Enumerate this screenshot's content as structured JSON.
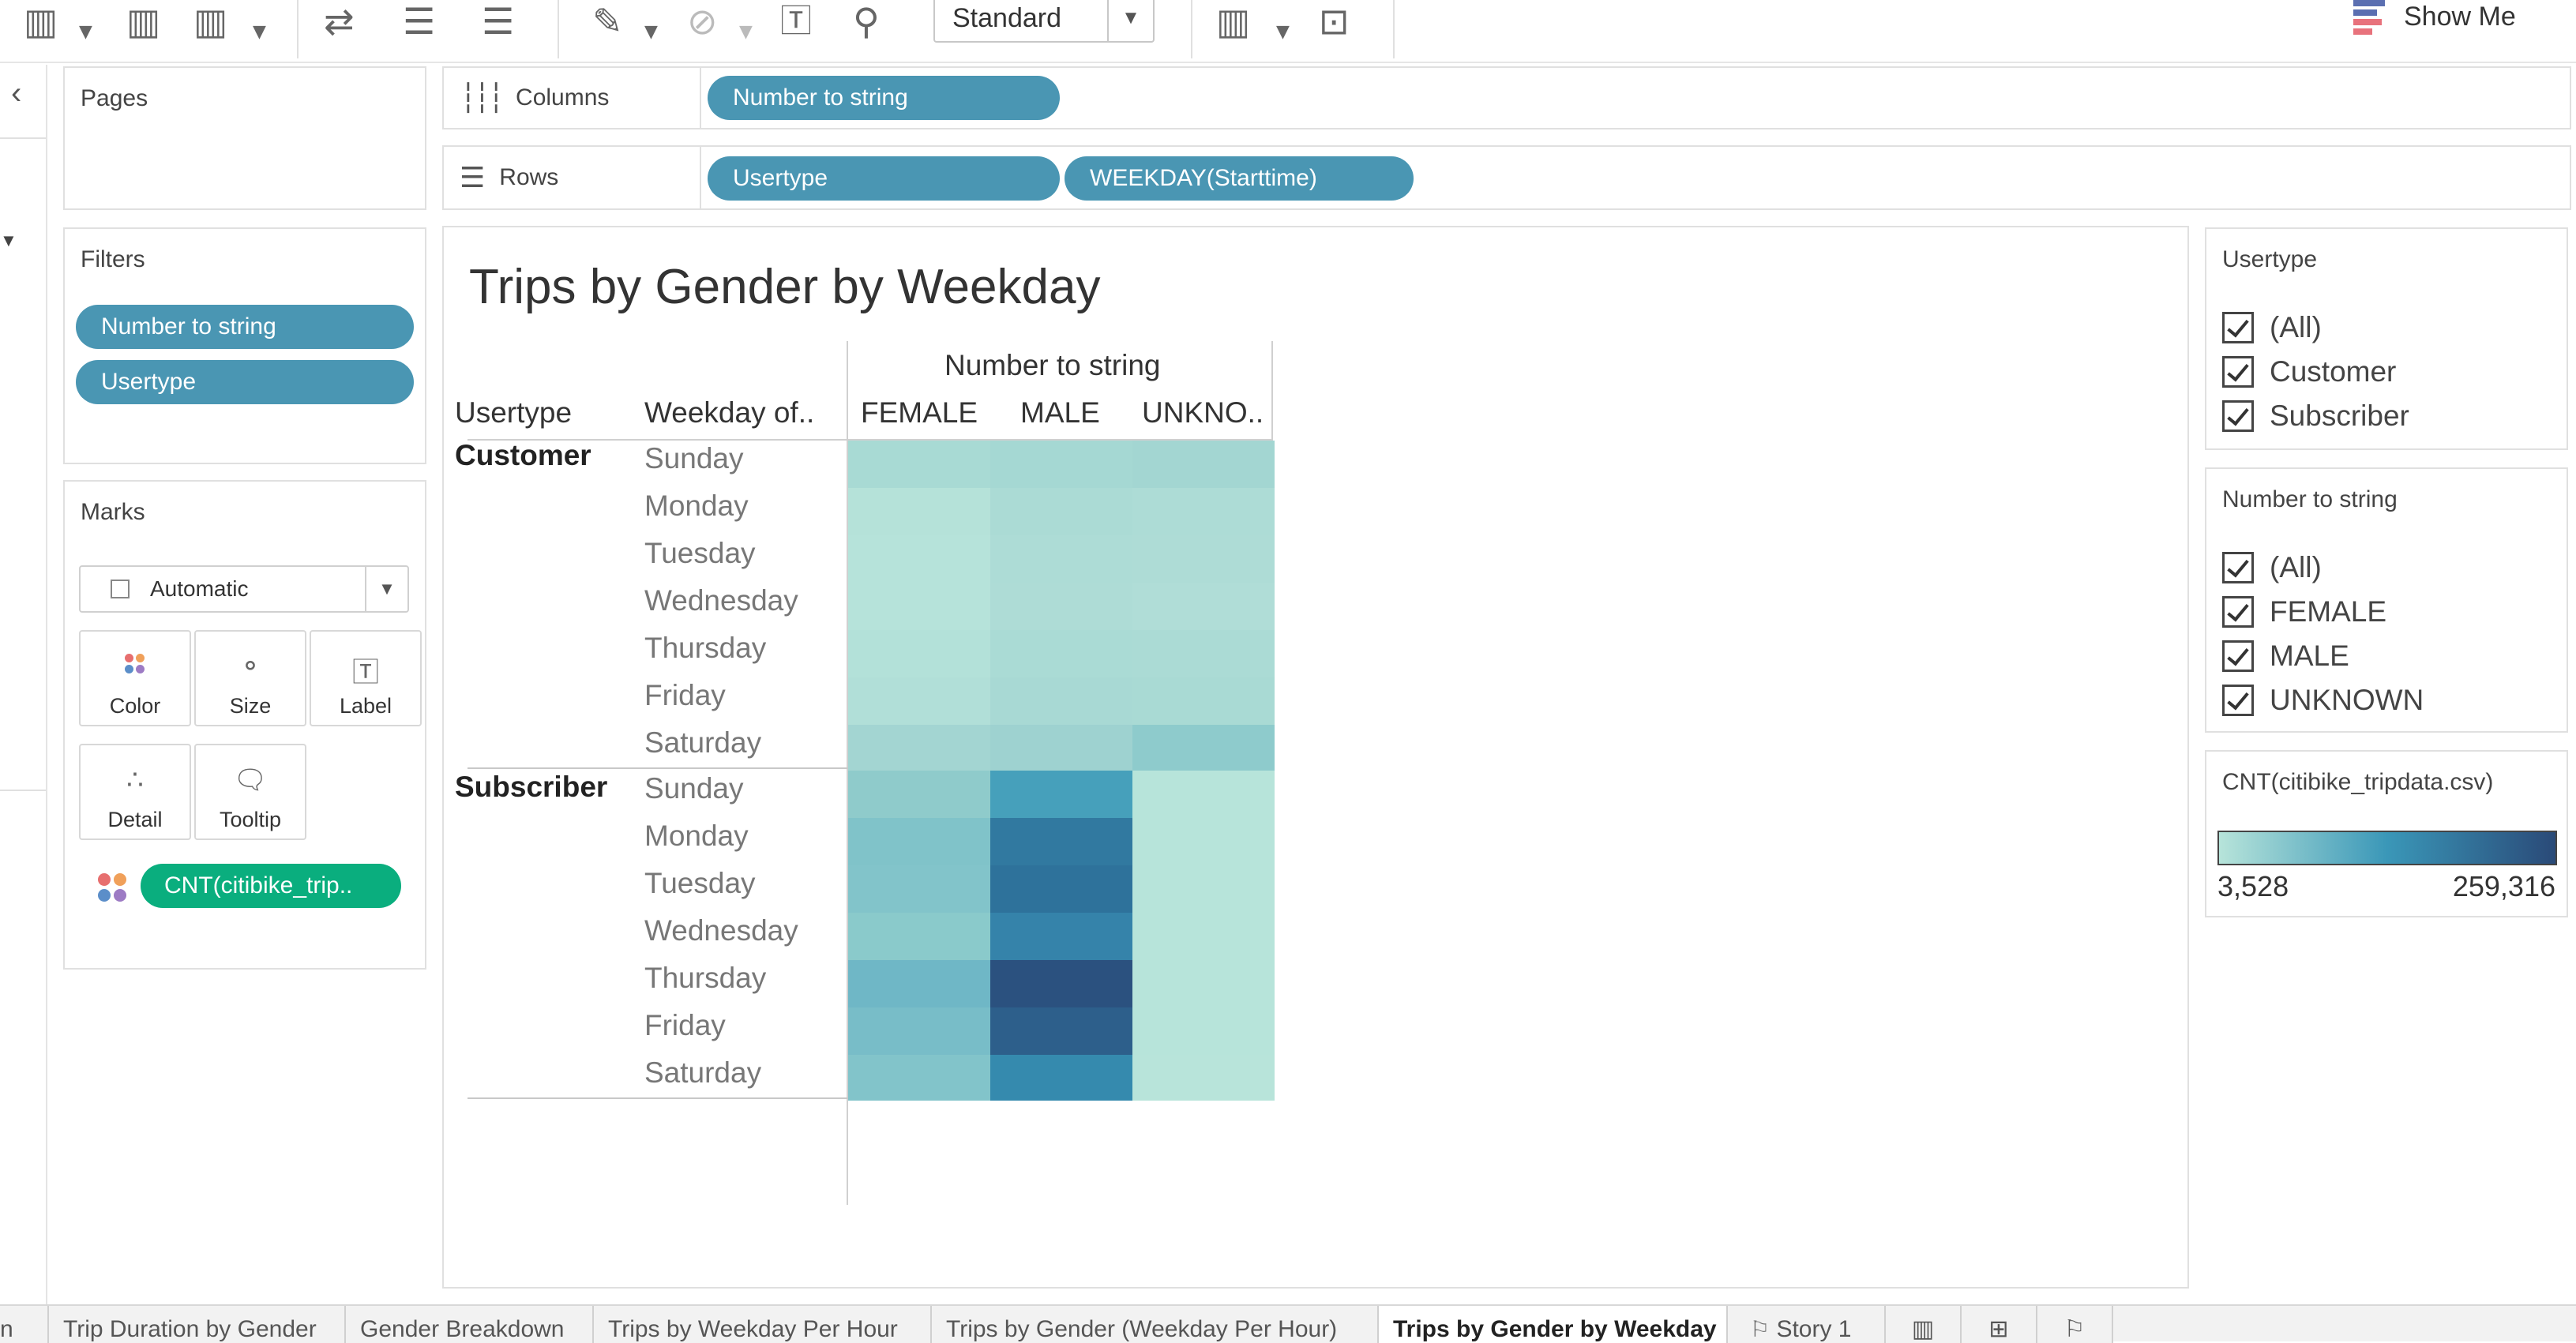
{
  "toolbar": {
    "format_select": "Standard",
    "show_me": "Show Me"
  },
  "pages": {
    "title": "Pages"
  },
  "filters": {
    "title": "Filters",
    "pills": [
      "Number to string",
      "Usertype"
    ]
  },
  "marks": {
    "title": "Marks",
    "mark_type": "Automatic",
    "buttons": [
      "Color",
      "Size",
      "Label",
      "Detail",
      "Tooltip"
    ],
    "measure_pill": "CNT(citibike_trip.."
  },
  "shelves": {
    "columns_label": "Columns",
    "columns_pills": [
      "Number to string"
    ],
    "rows_label": "Rows",
    "rows_pills": [
      "Usertype",
      "WEEKDAY(Starttime)"
    ]
  },
  "viz": {
    "title": "Trips by Gender by Weekday",
    "column_header": "Number to string",
    "row_header_1": "Usertype",
    "row_header_2": "Weekday of..",
    "columns": [
      "FEMALE",
      "MALE",
      "UNKNO.."
    ],
    "groups": [
      {
        "name": "Customer",
        "days": [
          "Sunday",
          "Monday",
          "Tuesday",
          "Wednesday",
          "Thursday",
          "Friday",
          "Saturday"
        ]
      },
      {
        "name": "Subscriber",
        "days": [
          "Sunday",
          "Monday",
          "Tuesday",
          "Wednesday",
          "Thursday",
          "Friday",
          "Saturday"
        ]
      }
    ],
    "cell_colors": [
      [
        "#a8dad4",
        "#a5d8d3",
        "#a3d6d2"
      ],
      [
        "#b5e2d9",
        "#abdbd5",
        "#addcd6"
      ],
      [
        "#b6e3da",
        "#addcd6",
        "#aedcd6"
      ],
      [
        "#b6e3da",
        "#aedcd6",
        "#b0ddd7"
      ],
      [
        "#b3e1d9",
        "#aadbd5",
        "#abdbd5"
      ],
      [
        "#b1dfd8",
        "#a8d9d4",
        "#a9dad4"
      ],
      [
        "#a3d5d2",
        "#9ed2d0",
        "#8ecbcc"
      ],
      [
        "#8fcbcb",
        "#46a0bb",
        "#b7e4da"
      ],
      [
        "#80c3c9",
        "#3179a0",
        "#b7e4da"
      ],
      [
        "#82c4ca",
        "#2e729b",
        "#b7e4da"
      ],
      [
        "#8acacb",
        "#3583aa",
        "#b7e4da"
      ],
      [
        "#6fb7c6",
        "#2b517f",
        "#b7e4da"
      ],
      [
        "#78bdc8",
        "#2d5f8b",
        "#b7e4da"
      ],
      [
        "#82c4ca",
        "#358aae",
        "#b8e4da"
      ]
    ]
  },
  "legend_usertype": {
    "title": "Usertype",
    "items": [
      "(All)",
      "Customer",
      "Subscriber"
    ]
  },
  "legend_gender": {
    "title": "Number to string",
    "items": [
      "(All)",
      "FEMALE",
      "MALE",
      "UNKNOWN"
    ]
  },
  "legend_color": {
    "title": "CNT(citibike_tripdata.csv)",
    "min": "3,528",
    "max": "259,316",
    "gradient_start": "#b7e4da",
    "gradient_mid": "#3a97b8",
    "gradient_end": "#2a4a78"
  },
  "tabs": {
    "items": [
      "n",
      "Trip Duration by Gender",
      "Gender Breakdown",
      "Trips by Weekday Per Hour",
      "Trips by Gender (Weekday Per Hour)",
      "Trips by Gender by Weekday",
      "Story 1"
    ],
    "active": "Trips by Gender by Weekday"
  }
}
